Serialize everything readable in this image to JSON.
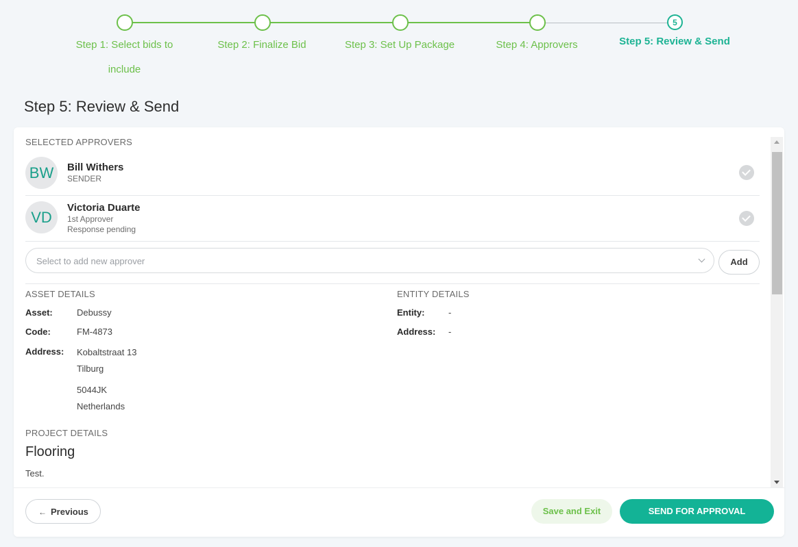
{
  "stepper": {
    "steps": [
      {
        "label": "Step 1: Select bids to include",
        "line1": "Step 1: Select bids to",
        "line2": "include"
      },
      {
        "label": "Step 2: Finalize Bid"
      },
      {
        "label": "Step 3: Set Up Package"
      },
      {
        "label": "Step 4: Approvers"
      },
      {
        "label": "Step 5: Review & Send",
        "number": "5"
      }
    ],
    "colors": {
      "done": "#6cc04a",
      "active": "#1db394",
      "pending": "#b9bec4"
    }
  },
  "page": {
    "title": "Step 5: Review & Send"
  },
  "approvers": {
    "section_title": "SELECTED APPROVERS",
    "items": [
      {
        "initials": "BW",
        "name": "Bill Withers",
        "role": "SENDER",
        "status": ""
      },
      {
        "initials": "VD",
        "name": "Victoria Duarte",
        "role": "1st Approver",
        "status": "Response pending"
      }
    ],
    "select_placeholder": "Select to add new approver",
    "add_label": "Add"
  },
  "asset": {
    "section_title": "ASSET DETAILS",
    "asset_key": "Asset:",
    "asset_val": "Debussy",
    "code_key": "Code:",
    "code_val": "FM-4873",
    "address_key": "Address:",
    "address_lines": [
      "Kobaltstraat 13",
      "Tilburg",
      "5044JK",
      "Netherlands"
    ]
  },
  "entity": {
    "section_title": "ENTITY DETAILS",
    "entity_key": "Entity:",
    "entity_val": "-",
    "address_key": "Address:",
    "address_val": "-"
  },
  "project": {
    "section_title": "PROJECT DETAILS",
    "name": "Flooring",
    "description": "Test."
  },
  "footer": {
    "previous_label": "Previous",
    "save_label": "Save and Exit",
    "send_label": "SEND FOR APPROVAL"
  }
}
